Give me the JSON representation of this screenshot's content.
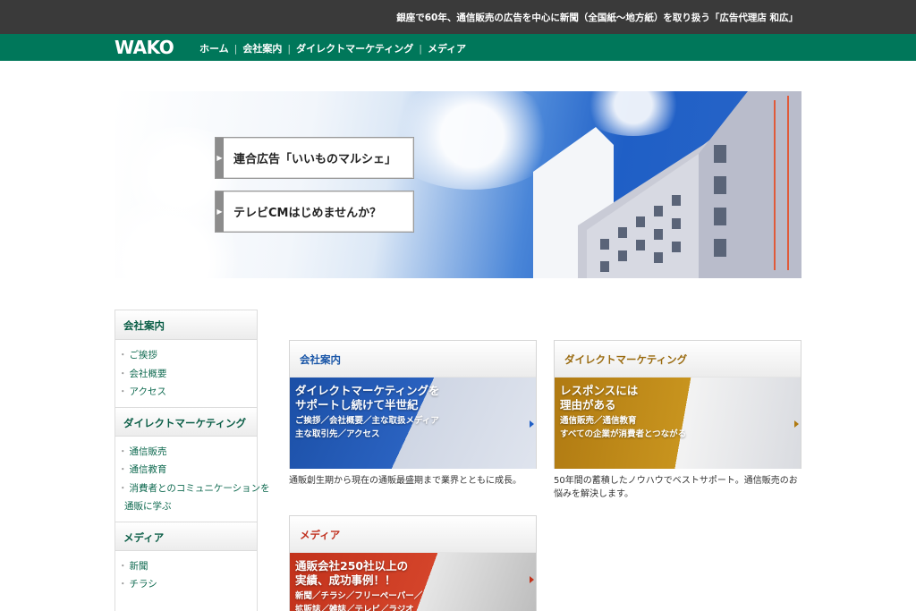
{
  "header": {
    "tagline": "銀座で60年、通信販売の広告を中心に新聞（全国紙〜地方紙）を取り扱う「広告代理店 和広」"
  },
  "nav": {
    "logo": "WAKO",
    "items": [
      {
        "label": "ホーム"
      },
      {
        "label": "会社案内"
      },
      {
        "label": "ダイレクトマーケティング"
      },
      {
        "label": "メディア"
      }
    ],
    "separator": "|"
  },
  "hero": {
    "buttons": [
      {
        "label": "連合広告「いいものマルシェ」"
      },
      {
        "label": "テレビCMはじめませんか？"
      }
    ]
  },
  "sidebar": {
    "bullet": "・",
    "sections": [
      {
        "heading": "会社案内",
        "items": [
          "ご挨拶",
          "会社概要",
          "アクセス"
        ]
      },
      {
        "heading": "ダイレクトマーケティング",
        "items": [
          "通信販売",
          "通信教育",
          "消費者とのコミュニケーションを",
          "通販に学ぶ"
        ]
      },
      {
        "heading": "メディア",
        "items": [
          "新聞",
          "チラシ"
        ]
      }
    ]
  },
  "cards": [
    {
      "heading": "会社案内",
      "banner_title_1": "ダイレクトマーケティングを",
      "banner_title_2": "サポートし続けて半世紀",
      "banner_sub_1": "ご挨拶／会社概要／主な取扱メディア",
      "banner_sub_2": "主な取引先／アクセス",
      "description": "通販創生期から現在の通販最盛期まで業界とともに成長。"
    },
    {
      "heading": "ダイレクトマーケティング",
      "banner_title_1": "レスポンスには",
      "banner_title_2": "理由がある",
      "banner_sub_1": "通信販売／通信教育",
      "banner_sub_2": "すべての企業が消費者とつながる",
      "description": "50年間の蓄積したノウハウでベストサポート。通信販売のお悩みを解決します。"
    },
    {
      "heading": "メディア",
      "banner_title_1": "通販会社250社以上の",
      "banner_title_2": "実績、成功事例！！",
      "banner_sub_1": "新聞／チラシ／フリーペーパー／",
      "banner_sub_2": "拡販誌／雑誌／テレビ／ラジオ"
    }
  ],
  "colors": {
    "header_bg": "#3a3a3a",
    "nav_bg": "#00775a",
    "link_green": "#0f6a50",
    "blue_accent": "#1b57a8",
    "gold_accent": "#9a6b10",
    "red_accent": "#c0301e"
  }
}
